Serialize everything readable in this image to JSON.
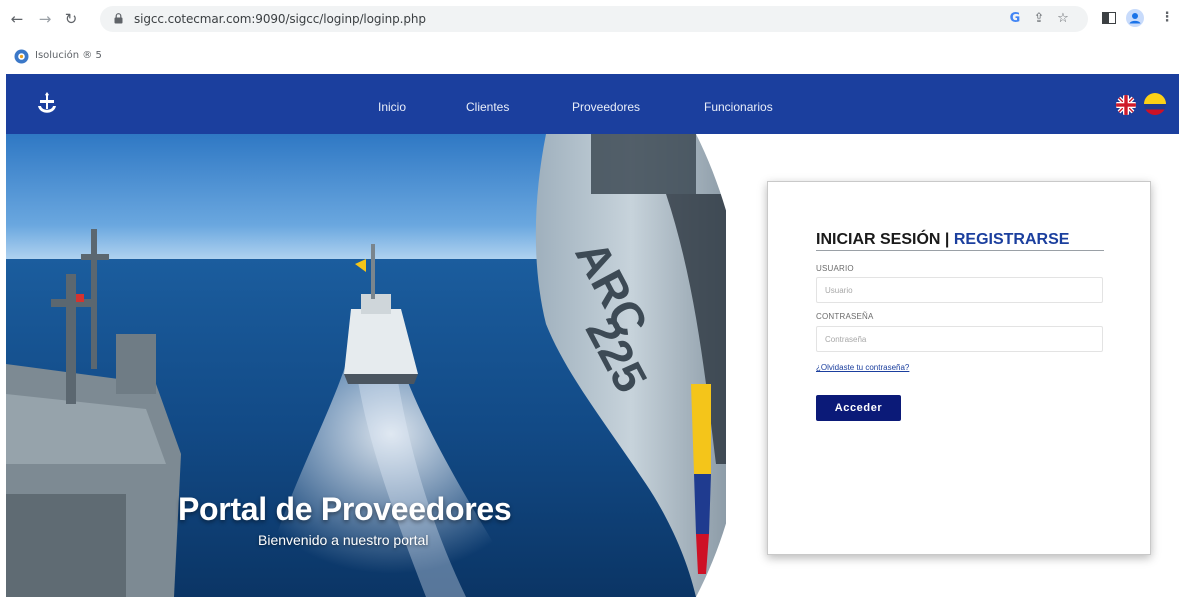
{
  "browser": {
    "url": "sigcc.cotecmar.com:9090/sigcc/loginp/loginp.php",
    "bookmark_label": "Isolución ® 5",
    "icons": [
      "back-icon",
      "forward-icon",
      "reload-icon",
      "lock-icon",
      "google-translate-icon",
      "share-icon",
      "star-icon",
      "sidebar-icon",
      "profile-icon",
      "menu-icon"
    ]
  },
  "header": {
    "nav": [
      "Inicio",
      "Clientes",
      "Proveedores",
      "Funcionarios"
    ],
    "colors": {
      "bar": "#1b3f9e"
    }
  },
  "hero": {
    "title": "Portal de Proveedores",
    "subtitle": "Bienvenido a nuestro portal",
    "helicopter_marking": "ARC 225"
  },
  "login": {
    "heading_login": "INICIAR SESIÓN",
    "heading_separator": "|",
    "heading_register": "REGISTRARSE",
    "user_label": "USUARIO",
    "user_placeholder": "Usuario",
    "user_value": "",
    "password_label": "CONTRASEÑA",
    "password_placeholder": "Contraseña",
    "password_value": "",
    "forgot_text": "¿Olvidaste tu contraseña?",
    "submit_label": "Acceder",
    "colors": {
      "button": "#0b1a78",
      "accent": "#1b3f9e"
    }
  }
}
